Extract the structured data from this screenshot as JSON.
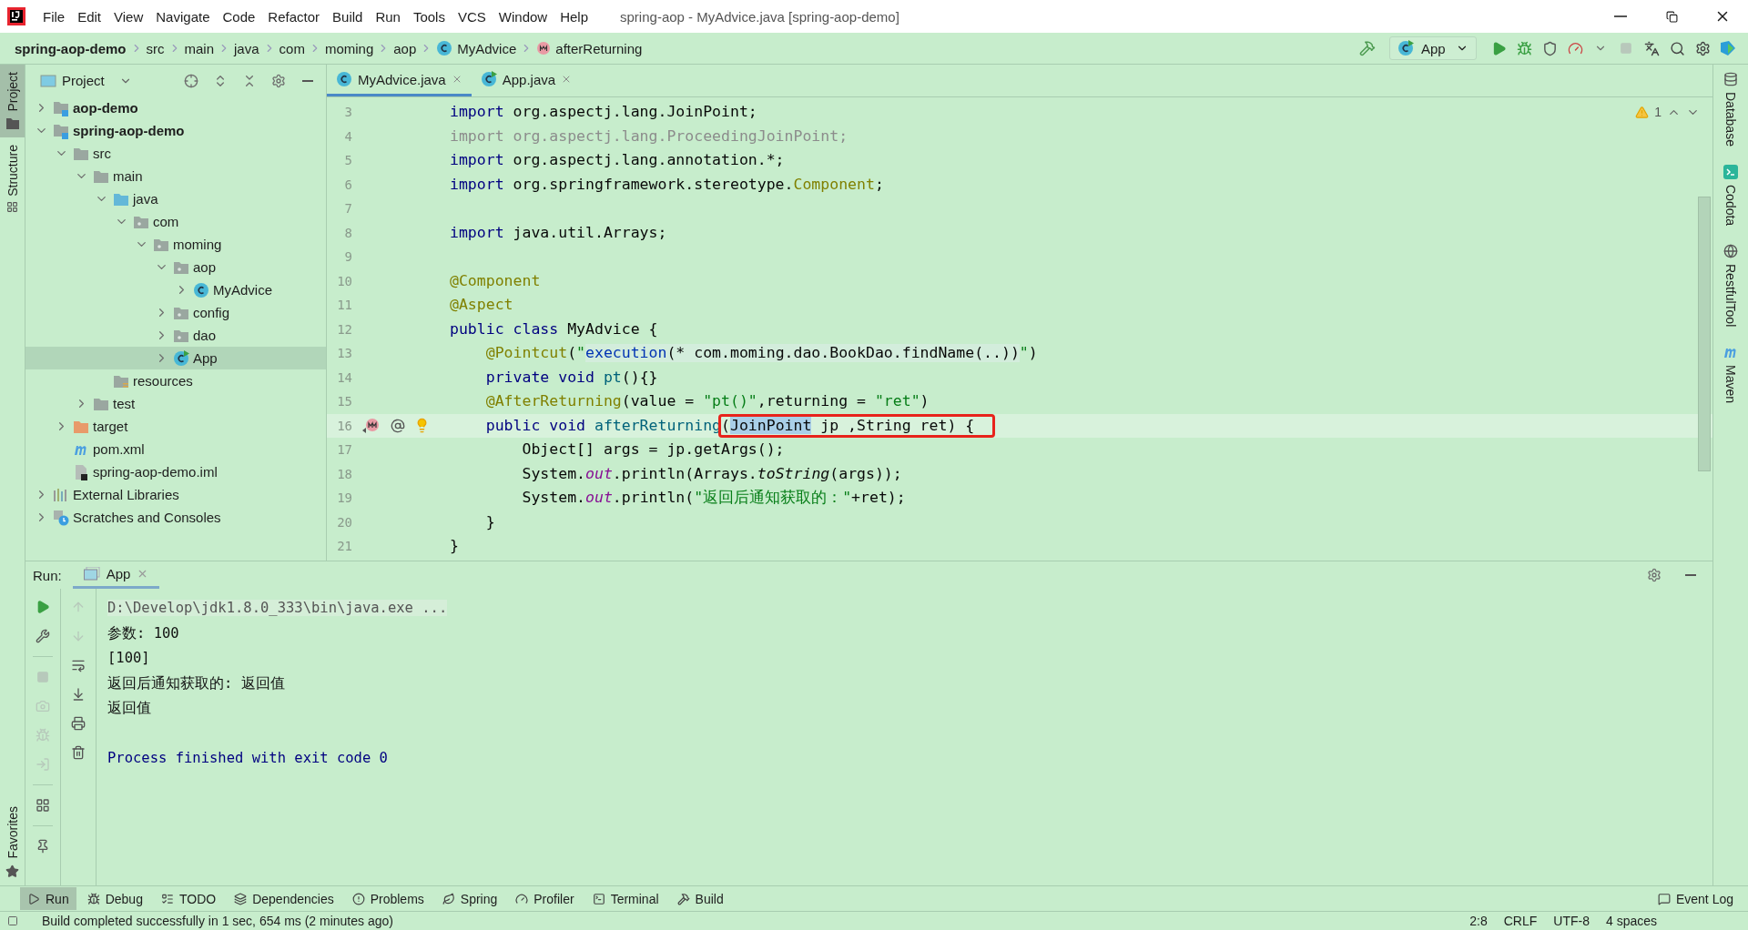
{
  "menu": [
    {
      "label": "File"
    },
    {
      "label": "Edit"
    },
    {
      "label": "View"
    },
    {
      "label": "Navigate"
    },
    {
      "label": "Code"
    },
    {
      "label": "Refactor"
    },
    {
      "label": "Build"
    },
    {
      "label": "Run"
    },
    {
      "label": "Tools"
    },
    {
      "label": "VCS"
    },
    {
      "label": "Window"
    },
    {
      "label": "Help"
    }
  ],
  "window": {
    "title": "spring-aop - MyAdvice.java [spring-aop-demo]"
  },
  "breadcrumbs": [
    {
      "label": "spring-aop-demo",
      "kind": "project"
    },
    {
      "label": "src",
      "kind": "plain"
    },
    {
      "label": "main",
      "kind": "plain"
    },
    {
      "label": "java",
      "kind": "plain"
    },
    {
      "label": "com",
      "kind": "plain"
    },
    {
      "label": "moming",
      "kind": "plain"
    },
    {
      "label": "aop",
      "kind": "plain"
    },
    {
      "label": "MyAdvice",
      "kind": "class"
    },
    {
      "label": "afterReturning",
      "kind": "method"
    }
  ],
  "run_config": {
    "label": "App"
  },
  "left_tool_tabs": [
    {
      "label": "Project",
      "kind": "project",
      "selected": true
    },
    {
      "label": "Structure",
      "kind": "structure",
      "selected": false
    }
  ],
  "favorites_tab": {
    "label": "Favorites"
  },
  "project_panel": {
    "title": "Project",
    "tree": [
      {
        "label": "aop-demo",
        "kind": "module",
        "expanded": false,
        "selected": false
      },
      {
        "label": "spring-aop-demo",
        "kind": "module",
        "expanded": true,
        "selected": false,
        "children": [
          {
            "label": "src",
            "kind": "folder",
            "expanded": true,
            "selected": false,
            "children": [
              {
                "label": "main",
                "kind": "folder",
                "expanded": true,
                "selected": false,
                "children": [
                  {
                    "label": "java",
                    "kind": "source",
                    "expanded": true,
                    "selected": false,
                    "children": [
                      {
                        "label": "com",
                        "kind": "package",
                        "expanded": true,
                        "selected": false,
                        "children": [
                          {
                            "label": "moming",
                            "kind": "package",
                            "expanded": true,
                            "selected": false,
                            "children": [
                              {
                                "label": "aop",
                                "kind": "package",
                                "expanded": true,
                                "selected": false,
                                "children": [
                                  {
                                    "label": "MyAdvice",
                                    "kind": "class",
                                    "expanded": false,
                                    "selected": false
                                  }
                                ]
                              },
                              {
                                "label": "config",
                                "kind": "package",
                                "expanded": false,
                                "selected": false
                              },
                              {
                                "label": "dao",
                                "kind": "package",
                                "expanded": false,
                                "selected": false
                              },
                              {
                                "label": "App",
                                "kind": "runclass",
                                "expanded": false,
                                "selected": true
                              }
                            ]
                          }
                        ]
                      }
                    ]
                  },
                  {
                    "label": "resources",
                    "kind": "resources",
                    "selected": false
                  }
                ]
              },
              {
                "label": "test",
                "kind": "folder",
                "expanded": false,
                "selected": false
              }
            ]
          },
          {
            "label": "target",
            "kind": "excluded",
            "expanded": false,
            "selected": false
          },
          {
            "label": "pom.xml",
            "kind": "maven",
            "selected": false
          },
          {
            "label": "spring-aop-demo.iml",
            "kind": "iml",
            "selected": false
          }
        ]
      },
      {
        "label": "External Libraries",
        "kind": "libraries",
        "expanded": false,
        "selected": false
      },
      {
        "label": "Scratches and Consoles",
        "kind": "scratches",
        "expanded": false,
        "selected": false
      }
    ]
  },
  "editor": {
    "tabs": [
      {
        "label": "MyAdvice.java",
        "kind": "class",
        "selected": true
      },
      {
        "label": "App.java",
        "kind": "runclass",
        "selected": false
      }
    ],
    "warning_count": "1",
    "lines": [
      {
        "number": "3",
        "current": false,
        "tokens": [
          {
            "text": "import",
            "kind": "keyword"
          },
          {
            "text": " org.aspectj.lang.JoinPoint;",
            "kind": "plain"
          }
        ]
      },
      {
        "number": "4",
        "current": false,
        "tokens": [
          {
            "text": "import org.aspectj.lang.ProceedingJoinPoint;",
            "kind": "unused"
          }
        ]
      },
      {
        "number": "5",
        "current": false,
        "tokens": [
          {
            "text": "import",
            "kind": "keyword"
          },
          {
            "text": " org.aspectj.lang.annotation.*;",
            "kind": "plain"
          }
        ]
      },
      {
        "number": "6",
        "current": false,
        "tokens": [
          {
            "text": "import",
            "kind": "keyword"
          },
          {
            "text": " org.springframework.stereotype.",
            "kind": "plain"
          },
          {
            "text": "Component",
            "kind": "annotation"
          },
          {
            "text": ";",
            "kind": "plain"
          }
        ]
      },
      {
        "number": "7",
        "current": false
      },
      {
        "number": "8",
        "current": false,
        "tokens": [
          {
            "text": "import",
            "kind": "keyword"
          },
          {
            "text": " java.util.Arrays;",
            "kind": "plain"
          }
        ]
      },
      {
        "number": "9",
        "current": false
      },
      {
        "number": "10",
        "current": false,
        "tokens": [
          {
            "text": "@Component",
            "kind": "annotation"
          }
        ]
      },
      {
        "number": "11",
        "current": false,
        "tokens": [
          {
            "text": "@Aspect",
            "kind": "annotation"
          }
        ]
      },
      {
        "number": "12",
        "current": false,
        "tokens": [
          {
            "text": "public class",
            "kind": "keyword"
          },
          {
            "text": " MyAdvice {",
            "kind": "plain"
          }
        ]
      },
      {
        "number": "13",
        "current": false,
        "tokens": [
          {
            "text": "    @Pointcut",
            "kind": "annotation"
          },
          {
            "text": "(",
            "kind": "plain"
          },
          {
            "text": "\"",
            "kind": "string"
          },
          {
            "text": "execution",
            "kind": "aspect"
          },
          {
            "text": "(* com.moming.dao.BookDao.findName(..))",
            "kind": "injected"
          },
          {
            "text": "\"",
            "kind": "string"
          },
          {
            "text": ")",
            "kind": "plain"
          }
        ]
      },
      {
        "number": "14",
        "current": false,
        "tokens": [
          {
            "text": "    private void ",
            "kind": "keyword"
          },
          {
            "text": "pt",
            "kind": "method"
          },
          {
            "text": "(){}",
            "kind": "plain"
          }
        ]
      },
      {
        "number": "15",
        "current": false,
        "tokens": [
          {
            "text": "    @AfterReturning",
            "kind": "annotation"
          },
          {
            "text": "(value = ",
            "kind": "plain"
          },
          {
            "text": "\"pt()\"",
            "kind": "string"
          },
          {
            "text": ",returning = ",
            "kind": "plain"
          },
          {
            "text": "\"ret\"",
            "kind": "string"
          },
          {
            "text": ")",
            "kind": "plain"
          }
        ]
      },
      {
        "number": "16",
        "current": true,
        "markers": [
          {
            "kind": "implements"
          },
          {
            "kind": "at"
          },
          {
            "kind": "bulb"
          }
        ],
        "tokens": [
          {
            "text": "    public void ",
            "kind": "keyword"
          },
          {
            "text": "afterReturning",
            "kind": "method"
          }
        ],
        "boxed": [
          {
            "text": "(",
            "kind": "plain"
          },
          {
            "text": "JoinPoint",
            "kind": "match"
          },
          {
            "text": " jp ,String ret) {",
            "kind": "plain"
          }
        ]
      },
      {
        "number": "17",
        "current": false,
        "tokens": [
          {
            "text": "        Object[] args = jp.getArgs();",
            "kind": "plain"
          }
        ]
      },
      {
        "number": "18",
        "current": false,
        "tokens": [
          {
            "text": "        System.",
            "kind": "plain"
          },
          {
            "text": "out",
            "kind": "field"
          },
          {
            "text": ".println(Arrays.",
            "kind": "plain"
          },
          {
            "text": "toString",
            "kind": "static"
          },
          {
            "text": "(args));",
            "kind": "plain"
          }
        ]
      },
      {
        "number": "19",
        "current": false,
        "tokens": [
          {
            "text": "        System.",
            "kind": "plain"
          },
          {
            "text": "out",
            "kind": "field"
          },
          {
            "text": ".println(",
            "kind": "plain"
          },
          {
            "text": "\"返回后通知获取的：\"",
            "kind": "string"
          },
          {
            "text": "+ret);",
            "kind": "plain"
          }
        ]
      },
      {
        "number": "20",
        "current": false,
        "tokens": [
          {
            "text": "    }",
            "kind": "plain"
          }
        ]
      },
      {
        "number": "21",
        "current": false,
        "tokens": [
          {
            "text": "}",
            "kind": "plain"
          }
        ]
      }
    ]
  },
  "right_tool_tabs": [
    {
      "label": "Database",
      "kind": "database"
    },
    {
      "label": "Codota",
      "kind": "codota"
    },
    {
      "label": "RestfulTool",
      "kind": "globe"
    },
    {
      "label": "Maven",
      "kind": "maven"
    }
  ],
  "run_panel": {
    "label": "Run:",
    "tabs": [
      {
        "label": "App",
        "selected": true
      }
    ],
    "output": [
      {
        "text": "D:\\Develop\\jdk1.8.0_333\\bin\\java.exe ...",
        "kind": "command"
      },
      {
        "text": "参数: 100",
        "kind": "normal"
      },
      {
        "text": "[100]",
        "kind": "normal"
      },
      {
        "text": "返回后通知获取的: 返回值",
        "kind": "normal"
      },
      {
        "text": "返回值",
        "kind": "normal"
      },
      {
        "text": "Process finished with exit code 0",
        "kind": "exit"
      }
    ]
  },
  "bottom_tabs": [
    {
      "label": "Run",
      "kind": "run",
      "selected": true
    },
    {
      "label": "Debug",
      "kind": "debug",
      "selected": false
    },
    {
      "label": "TODO",
      "kind": "todo",
      "selected": false
    },
    {
      "label": "Dependencies",
      "kind": "dependencies",
      "selected": false
    },
    {
      "label": "Problems",
      "kind": "problems",
      "selected": false
    },
    {
      "label": "Spring",
      "kind": "spring",
      "selected": false
    },
    {
      "label": "Profiler",
      "kind": "profiler",
      "selected": false
    },
    {
      "label": "Terminal",
      "kind": "terminal",
      "selected": false
    },
    {
      "label": "Build",
      "kind": "build",
      "selected": false
    }
  ],
  "event_log": {
    "label": "Event Log"
  },
  "status_bar": {
    "message": "Build completed successfully in 1 sec, 654 ms (2 minutes ago)",
    "items": [
      "2:8",
      "CRLF",
      "UTF-8",
      "4 spaces"
    ]
  }
}
